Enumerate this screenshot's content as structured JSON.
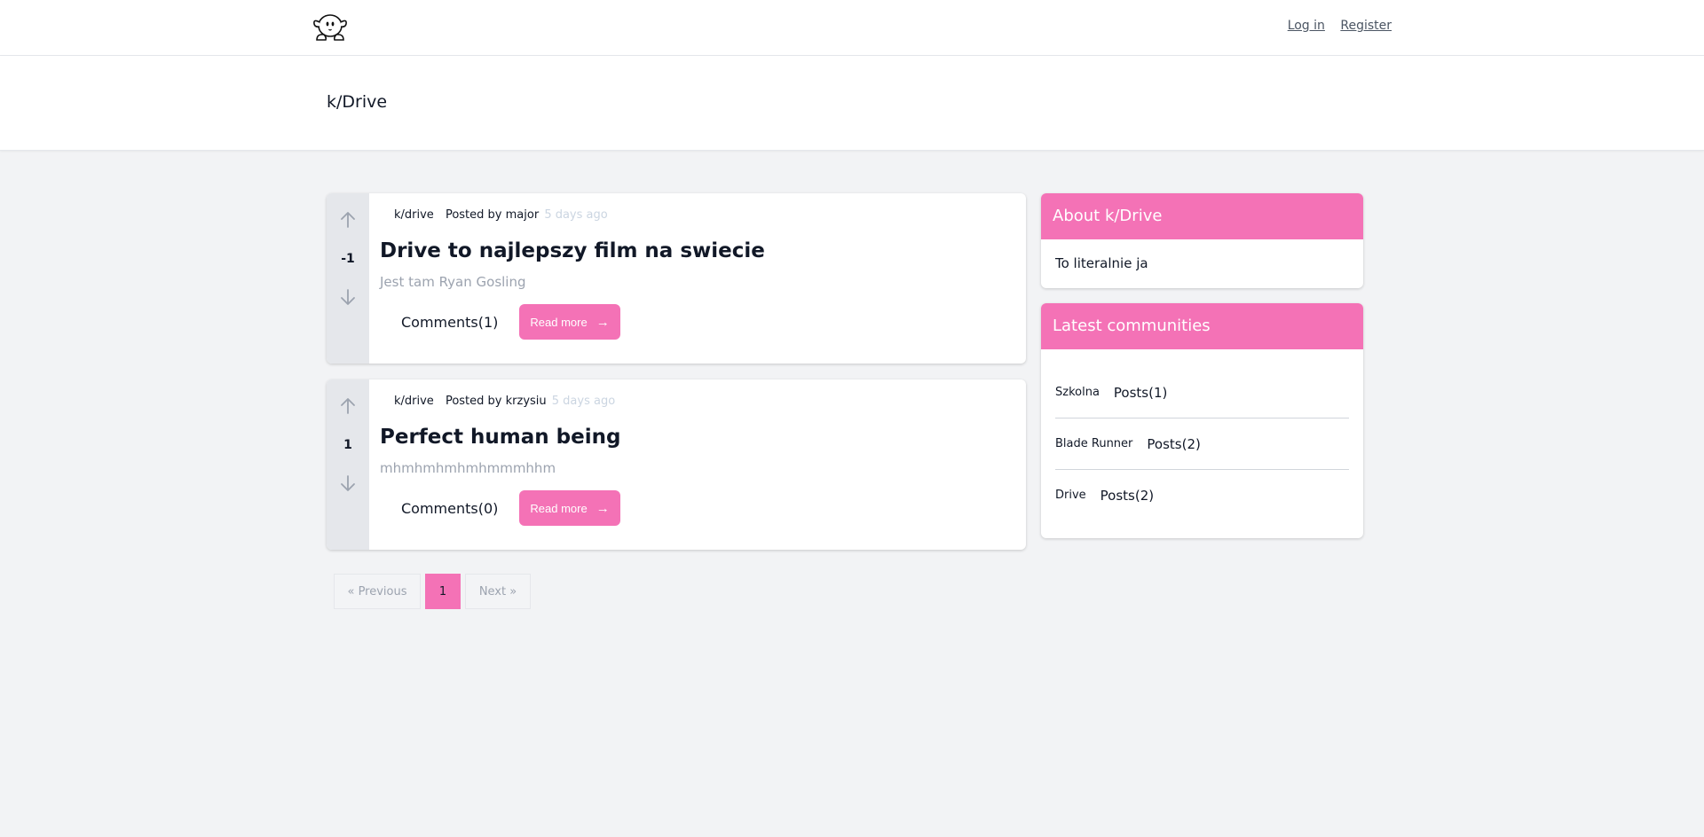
{
  "nav": {
    "login": "Log in",
    "register": "Register"
  },
  "header": {
    "title": "k/Drive"
  },
  "posts": [
    {
      "votes": "-1",
      "subreddit": "k/drive",
      "posted_by_label": "Posted by",
      "author": "major",
      "time": "5 days ago",
      "title": "Drive to najlepszy film na swiecie",
      "excerpt": "Jest tam Ryan Gosling",
      "comments": "Comments(1)",
      "read_more": "Read more"
    },
    {
      "votes": "1",
      "subreddit": "k/drive",
      "posted_by_label": "Posted by",
      "author": "krzysiu",
      "time": "5 days ago",
      "title": "Perfect human being",
      "excerpt": "mhmhmhmhmhmmmhhm",
      "comments": "Comments(0)",
      "read_more": "Read more"
    }
  ],
  "pagination": {
    "previous": "« Previous",
    "current": "1",
    "next": "Next »"
  },
  "sidebar": {
    "about": {
      "title": "About k/Drive",
      "text": "To literalnie ja"
    },
    "latest": {
      "title": "Latest communities",
      "items": [
        {
          "name": "Szkolna",
          "posts": "Posts(1)"
        },
        {
          "name": "Blade Runner",
          "posts": "Posts(2)"
        },
        {
          "name": "Drive",
          "posts": "Posts(2)"
        }
      ]
    }
  },
  "colors": {
    "accent": "#f472b6",
    "background": "#f2f3f5",
    "vote_column": "#e5e7eb"
  },
  "icons": {
    "logo": "kirby-logo-icon",
    "upvote": "arrow-up-icon",
    "downvote": "arrow-down-icon",
    "read_more": "arrow-right-icon"
  }
}
